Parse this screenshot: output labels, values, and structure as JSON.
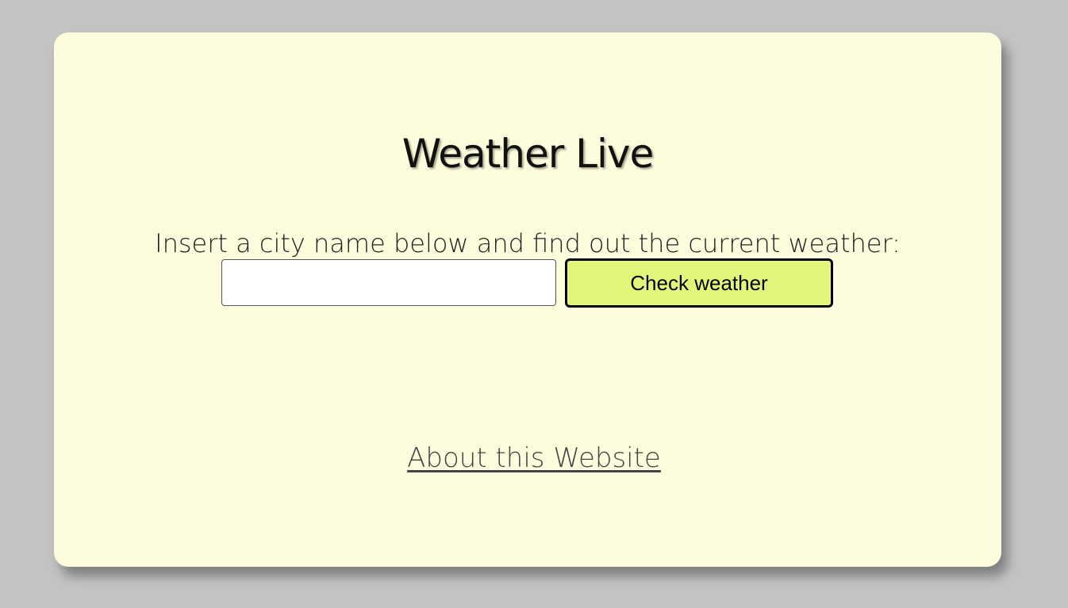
{
  "app": {
    "title": "Weather Live",
    "instruction": "Insert a city name below and find out the current weather:",
    "city_input": {
      "value": "",
      "placeholder": ""
    },
    "check_button_label": "Check weather",
    "about_link_label": "About this Website"
  },
  "colors": {
    "page_background": "#c3c3c3",
    "card_background": "#fdfcdc",
    "button_background": "#e4f67a"
  }
}
